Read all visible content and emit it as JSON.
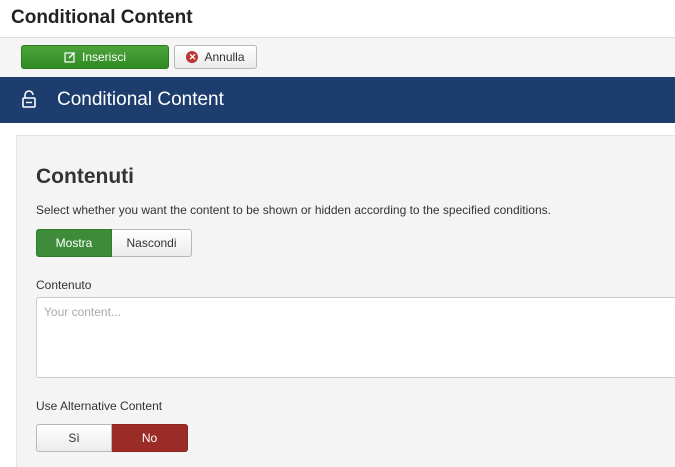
{
  "window": {
    "title": "Conditional Content"
  },
  "toolbar": {
    "insert_label": "Inserisci",
    "cancel_label": "Annulla"
  },
  "header": {
    "title": "Conditional Content",
    "icon": "unlock-icon"
  },
  "section": {
    "title": "Contenuti",
    "description": "Select whether you want the content to be shown or hidden according to the specified conditions."
  },
  "visibility_toggle": {
    "options": [
      "Mostra",
      "Nascondi"
    ],
    "selected": "Mostra"
  },
  "content_field": {
    "label": "Contenuto",
    "placeholder": "Your content...",
    "value": ""
  },
  "alternative": {
    "label": "Use Alternative Content",
    "options": [
      "Sì",
      "No"
    ],
    "selected": "No"
  },
  "colors": {
    "header_bg": "#1c3d6e",
    "success": "#3e8b3a",
    "danger": "#9b2b26"
  }
}
